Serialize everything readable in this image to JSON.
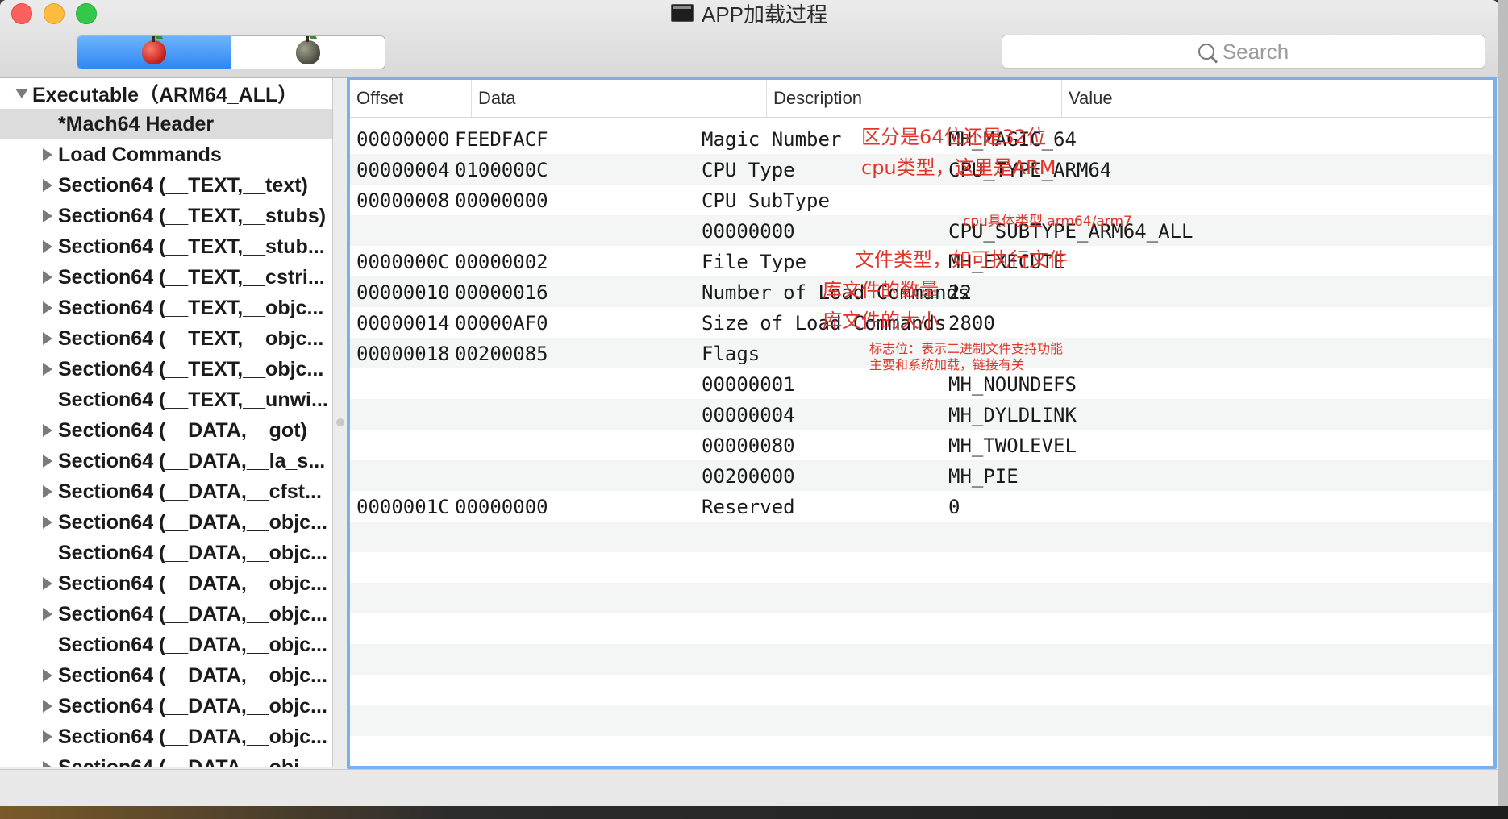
{
  "window": {
    "title": "APP加载过程"
  },
  "search": {
    "placeholder": "Search"
  },
  "sidebar": {
    "items": [
      {
        "label": "Executable（ARM64_ALL）",
        "level": 0,
        "disclosure": "down",
        "selected": false
      },
      {
        "label": "*Mach64 Header",
        "level": 1,
        "disclosure": "none",
        "selected": true
      },
      {
        "label": "Load Commands",
        "level": 1,
        "disclosure": "right",
        "selected": false
      },
      {
        "label": "Section64 (__TEXT,__text)",
        "level": 1,
        "disclosure": "right",
        "selected": false
      },
      {
        "label": "Section64 (__TEXT,__stubs)",
        "level": 1,
        "disclosure": "right",
        "selected": false
      },
      {
        "label": "Section64 (__TEXT,__stub...",
        "level": 1,
        "disclosure": "right",
        "selected": false
      },
      {
        "label": "Section64 (__TEXT,__cstri...",
        "level": 1,
        "disclosure": "right",
        "selected": false
      },
      {
        "label": "Section64 (__TEXT,__objc...",
        "level": 1,
        "disclosure": "right",
        "selected": false
      },
      {
        "label": "Section64 (__TEXT,__objc...",
        "level": 1,
        "disclosure": "right",
        "selected": false
      },
      {
        "label": "Section64 (__TEXT,__objc...",
        "level": 1,
        "disclosure": "right",
        "selected": false
      },
      {
        "label": "Section64 (__TEXT,__unwi...",
        "level": 1,
        "disclosure": "none",
        "selected": false
      },
      {
        "label": "Section64 (__DATA,__got)",
        "level": 1,
        "disclosure": "right",
        "selected": false
      },
      {
        "label": "Section64 (__DATA,__la_s...",
        "level": 1,
        "disclosure": "right",
        "selected": false
      },
      {
        "label": "Section64 (__DATA,__cfst...",
        "level": 1,
        "disclosure": "right",
        "selected": false
      },
      {
        "label": "Section64 (__DATA,__objc...",
        "level": 1,
        "disclosure": "right",
        "selected": false
      },
      {
        "label": "Section64 (__DATA,__objc...",
        "level": 1,
        "disclosure": "none",
        "selected": false
      },
      {
        "label": "Section64 (__DATA,__objc...",
        "level": 1,
        "disclosure": "right",
        "selected": false
      },
      {
        "label": "Section64 (__DATA,__objc...",
        "level": 1,
        "disclosure": "right",
        "selected": false
      },
      {
        "label": "Section64 (__DATA,__objc...",
        "level": 1,
        "disclosure": "none",
        "selected": false
      },
      {
        "label": "Section64 (__DATA,__objc...",
        "level": 1,
        "disclosure": "right",
        "selected": false
      },
      {
        "label": "Section64 (__DATA,__objc...",
        "level": 1,
        "disclosure": "right",
        "selected": false
      },
      {
        "label": "Section64 (__DATA,__objc...",
        "level": 1,
        "disclosure": "right",
        "selected": false
      },
      {
        "label": "Section64 (__DATA,__obj...",
        "level": 1,
        "disclosure": "right",
        "selected": false
      }
    ]
  },
  "table": {
    "headers": [
      "Offset",
      "Data",
      "Description",
      "Value"
    ],
    "rows": [
      {
        "offset": "00000000",
        "data": "FEEDFACF",
        "desc": "Magic Number",
        "value": "MH_MAGIC_64",
        "note": "区分是64位还是32位"
      },
      {
        "offset": "00000004",
        "data": "0100000C",
        "desc": "CPU Type",
        "value": "CPU_TYPE_ARM64",
        "note": "cpu类型，这里是ARM"
      },
      {
        "offset": "00000008",
        "data": "00000000",
        "desc": "CPU SubType",
        "value": "",
        "note": ""
      },
      {
        "offset": "",
        "data": "",
        "desc": "00000000",
        "value": "CPU_SUBTYPE_ARM64_ALL",
        "note": "cpu具体类型 arm64/arm7"
      },
      {
        "offset": "0000000C",
        "data": "00000002",
        "desc": "File Type",
        "value": "MH_EXECUTE",
        "note": "文件类型，如可执行文件"
      },
      {
        "offset": "00000010",
        "data": "00000016",
        "desc": "Number of Load Commands",
        "value": "22",
        "note": "库文件的数量"
      },
      {
        "offset": "00000014",
        "data": "00000AF0",
        "desc": "Size of Load Commands",
        "value": "2800",
        "note": "库文件的大小"
      },
      {
        "offset": "00000018",
        "data": "00200085",
        "desc": "Flags",
        "value": "",
        "note": "标志位：表示二进制文件支持功能\n主要和系统加载，链接有关"
      },
      {
        "offset": "",
        "data": "",
        "desc": "00000001",
        "value": "MH_NOUNDEFS",
        "note": ""
      },
      {
        "offset": "",
        "data": "",
        "desc": "00000004",
        "value": "MH_DYLDLINK",
        "note": ""
      },
      {
        "offset": "",
        "data": "",
        "desc": "00000080",
        "value": "MH_TWOLEVEL",
        "note": ""
      },
      {
        "offset": "",
        "data": "",
        "desc": "00200000",
        "value": "MH_PIE",
        "note": ""
      },
      {
        "offset": "0000001C",
        "data": "00000000",
        "desc": "Reserved",
        "value": "0",
        "note": ""
      }
    ]
  },
  "colors": {
    "accent": "#2f87f4",
    "annotation": "#e0352b",
    "selection": "#dcdcdc"
  },
  "icons": [
    "red-apple-icon",
    "gray-apple-icon",
    "search-icon",
    "terminal-icon"
  ]
}
